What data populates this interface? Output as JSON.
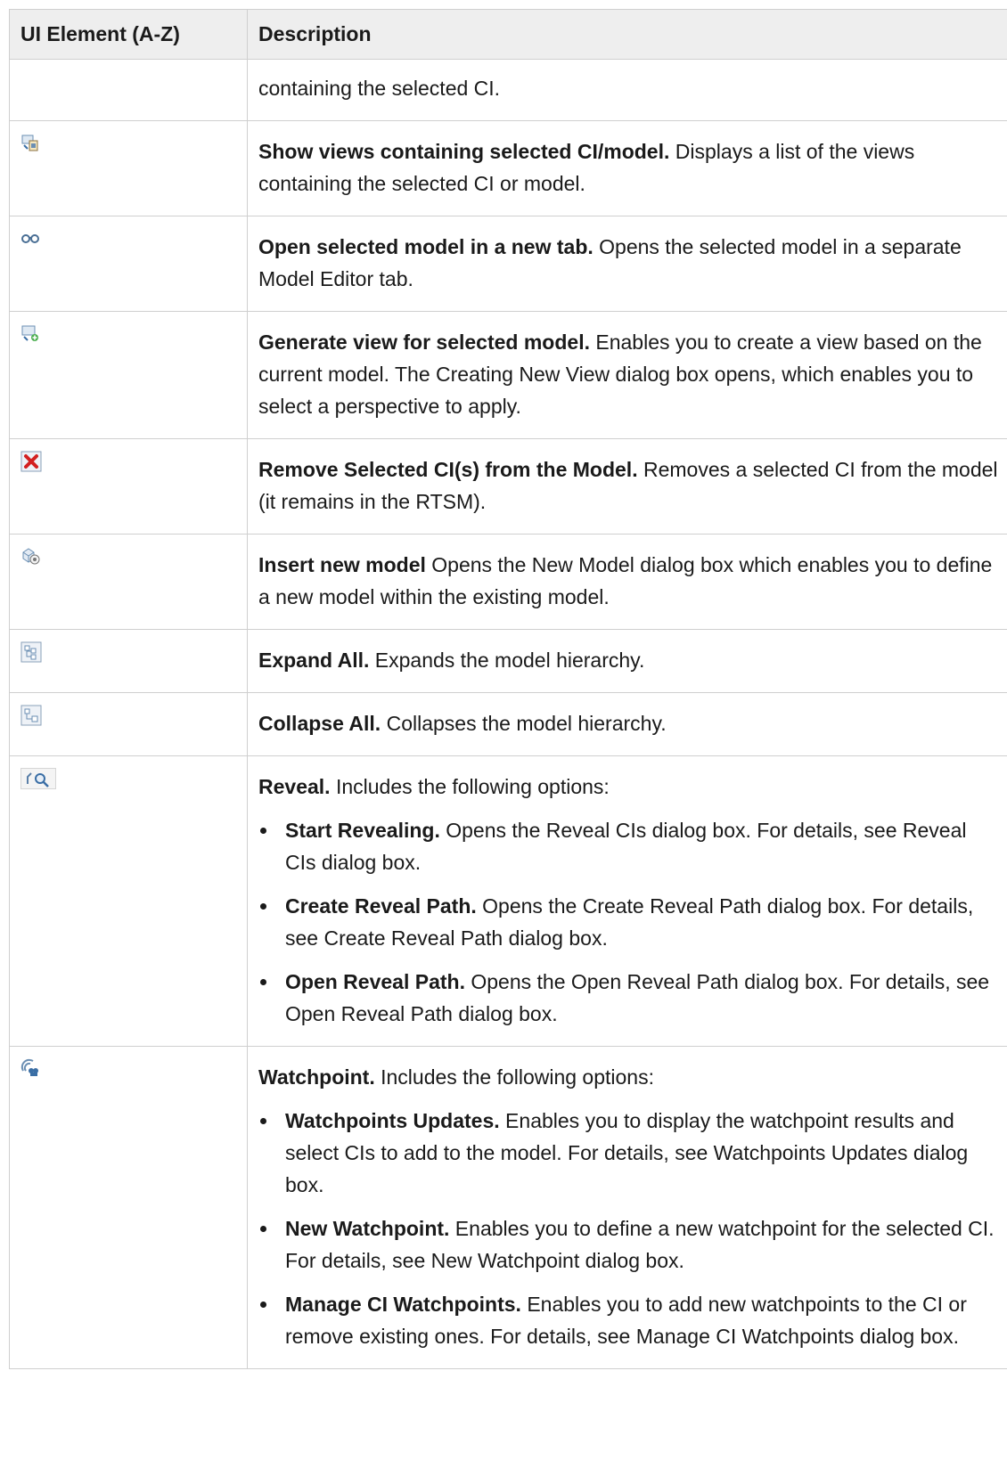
{
  "table": {
    "headers": {
      "element": "UI Element (A-Z)",
      "description": "Description"
    },
    "rows": [
      {
        "icon": "",
        "title": "",
        "text": "containing the selected CI."
      },
      {
        "icon": "show-views-icon",
        "title": "Show views containing selected CI/model.",
        "text": " Displays a list of the views containing the selected CI or model."
      },
      {
        "icon": "open-model-tab-icon",
        "title": "Open selected model in a new tab.",
        "text": " Opens the selected model in a separate Model Editor tab."
      },
      {
        "icon": "generate-view-icon",
        "title": "Generate view for selected model.",
        "text": " Enables you to create a view based on the current model. The Creating New View dialog box opens, which enables you to select a perspective to apply."
      },
      {
        "icon": "remove-ci-icon",
        "title": "Remove Selected CI(s) from the Model.",
        "text": " Removes a selected CI from the model (it remains in the RTSM)."
      },
      {
        "icon": "insert-model-icon",
        "title": "Insert new model",
        "text": " Opens the New Model dialog box which enables you to define a new model within the existing model."
      },
      {
        "icon": "expand-all-icon",
        "title": "Expand All.",
        "text": " Expands the model hierarchy."
      },
      {
        "icon": "collapse-all-icon",
        "title": "Collapse All.",
        "text": " Collapses the model hierarchy."
      },
      {
        "icon": "reveal-icon",
        "title": "Reveal.",
        "text": " Includes the following options:",
        "options": [
          {
            "title": "Start Revealing.",
            "text": " Opens the Reveal CIs dialog box. For details, see Reveal CIs dialog box."
          },
          {
            "title": "Create Reveal Path.",
            "text": " Opens the Create Reveal Path dialog box. For details, see Create Reveal Path dialog box."
          },
          {
            "title": "Open Reveal Path.",
            "text": " Opens the Open Reveal Path dialog box. For details, see Open Reveal Path dialog box."
          }
        ]
      },
      {
        "icon": "watchpoint-icon",
        "title": "Watchpoint.",
        "text": " Includes the following options:",
        "options": [
          {
            "title": "Watchpoints Updates.",
            "text": " Enables you to display the watchpoint results and select CIs to add to the model. For details, see Watchpoints Updates dialog box."
          },
          {
            "title": "New Watchpoint.",
            "text": " Enables you to define a new watchpoint for the selected CI. For details, see New Watchpoint dialog box."
          },
          {
            "title": "Manage CI Watchpoints.",
            "text": " Enables you to add new watchpoints to the CI or remove existing ones. For details, see Manage CI Watchpoints dialog box."
          }
        ]
      }
    ]
  }
}
